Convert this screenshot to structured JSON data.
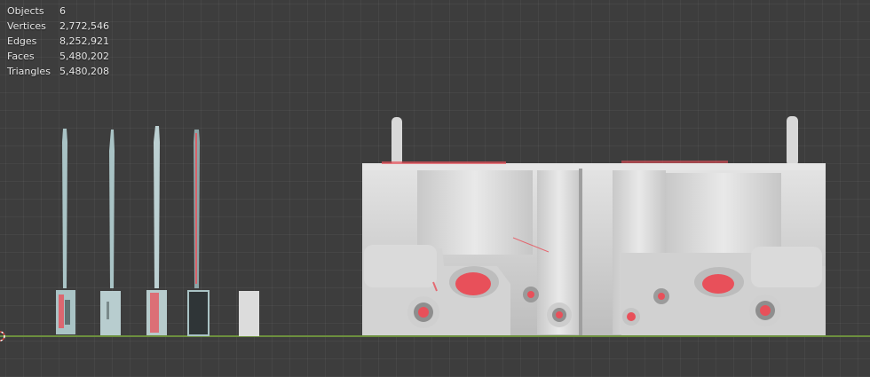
{
  "stats": {
    "rows": [
      {
        "label": "Objects",
        "value": "6"
      },
      {
        "label": "Vertices",
        "value": "2,772,546"
      },
      {
        "label": "Edges",
        "value": "8,252,921"
      },
      {
        "label": "Faces",
        "value": "5,480,202"
      },
      {
        "label": "Triangles",
        "value": "5,480,208"
      }
    ]
  },
  "colors": {
    "viewport_bg": "#3d3d3d",
    "ground_line": "#6c8f3e",
    "mesh_light": "#d9d9d9",
    "mesh_teal": "#a9c3c5",
    "highlight_red": "#e8505a"
  },
  "icons": {
    "origin": "3d-cursor-icon"
  }
}
